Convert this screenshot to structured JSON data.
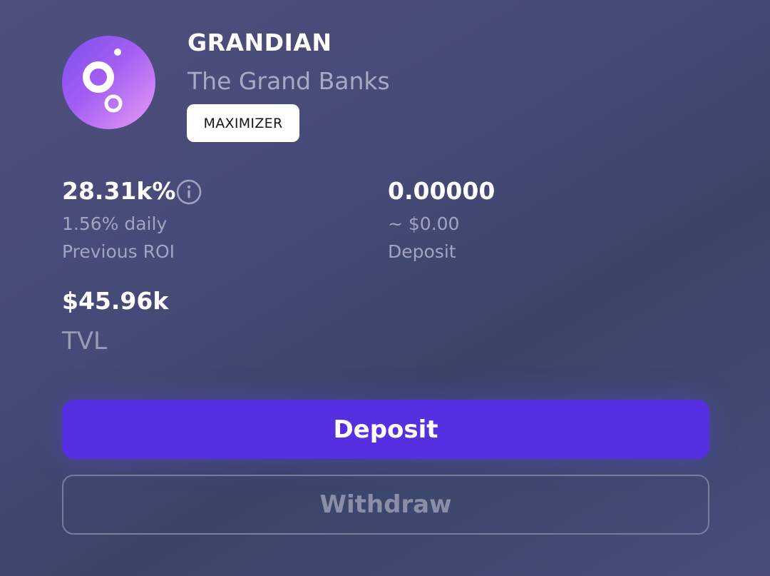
{
  "vault": {
    "name": "GRANDIAN",
    "platform": "The Grand Banks",
    "badge": "MAXIMIZER",
    "logo_icon": "grand-logo-icon"
  },
  "roi": {
    "value": "28.31k%",
    "daily": "1.56% daily",
    "label": "Previous ROI",
    "info_icon": "info-icon"
  },
  "deposit": {
    "value": "0.00000",
    "usd": "~ $0.00",
    "label": "Deposit"
  },
  "tvl": {
    "value": "$45.96k",
    "label": "TVL"
  },
  "actions": {
    "deposit_label": "Deposit",
    "withdraw_label": "Withdraw"
  },
  "colors": {
    "accent": "#5630e0",
    "logo_gradient_start": "#7a4ff0",
    "logo_gradient_end": "#e79cf7"
  }
}
